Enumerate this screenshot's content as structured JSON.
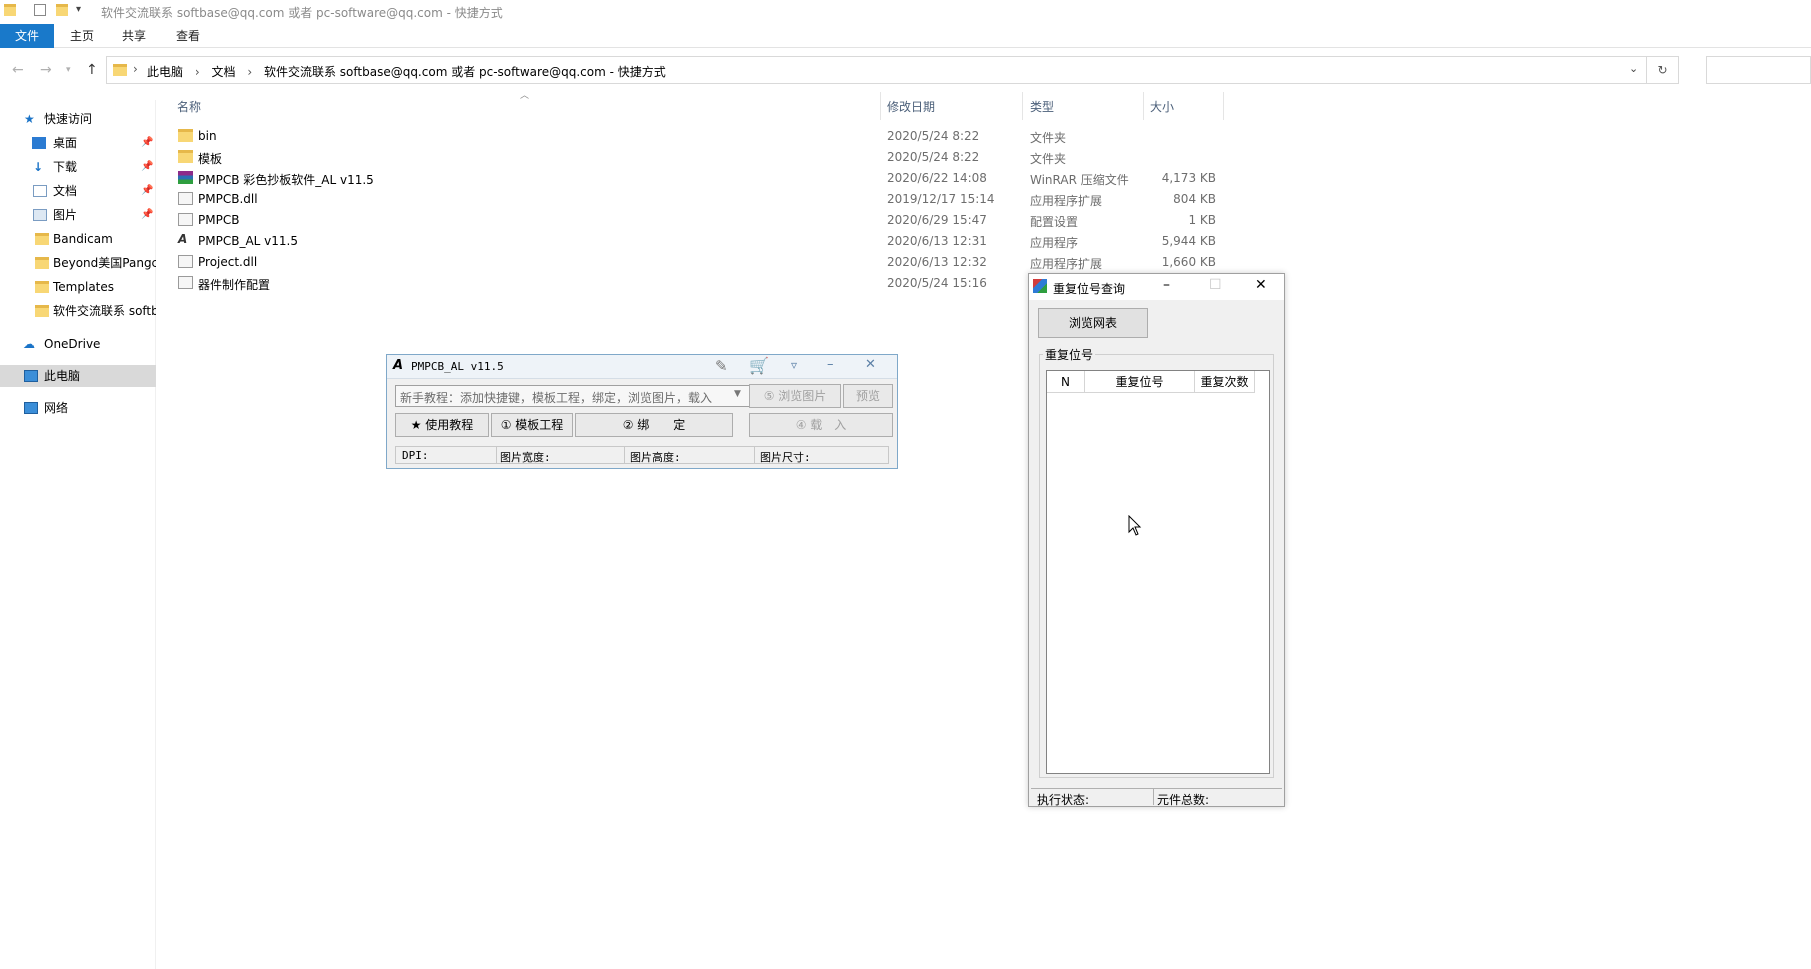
{
  "explorer": {
    "window_title": "软件交流联系 softbase@qq.com 或者 pc-software@qq.com - 快捷方式",
    "ribbon_tabs": [
      "文件",
      "主页",
      "共享",
      "查看"
    ],
    "breadcrumbs": [
      "此电脑",
      "文档",
      "软件交流联系 softbase@qq.com 或者 pc-software@qq.com - 快捷方式"
    ],
    "columns": {
      "name": "名称",
      "date": "修改日期",
      "type": "类型",
      "size": "大小"
    },
    "nav": [
      {
        "label": "快速访问"
      },
      {
        "label": "桌面"
      },
      {
        "label": "下载"
      },
      {
        "label": "文档"
      },
      {
        "label": "图片"
      },
      {
        "label": "Bandicam"
      },
      {
        "label": "Beyond美国Pangc"
      },
      {
        "label": "Templates"
      },
      {
        "label": "软件交流联系 softb"
      },
      {
        "label": "OneDrive"
      },
      {
        "label": "此电脑"
      },
      {
        "label": "网络"
      }
    ],
    "files": [
      {
        "name": "bin",
        "date": "2020/5/24 8:22",
        "type": "文件夹",
        "size": ""
      },
      {
        "name": "模板",
        "date": "2020/5/24 8:22",
        "type": "文件夹",
        "size": ""
      },
      {
        "name": "PMPCB 彩色抄板软件_AL v11.5",
        "date": "2020/6/22 14:08",
        "type": "WinRAR 压缩文件",
        "size": "4,173 KB"
      },
      {
        "name": "PMPCB.dll",
        "date": "2019/12/17 15:14",
        "type": "应用程序扩展",
        "size": "804 KB"
      },
      {
        "name": "PMPCB",
        "date": "2020/6/29 15:47",
        "type": "配置设置",
        "size": "1 KB"
      },
      {
        "name": "PMPCB_AL v11.5",
        "date": "2020/6/13 12:31",
        "type": "应用程序",
        "size": "5,944 KB"
      },
      {
        "name": "Project.dll",
        "date": "2020/6/13 12:32",
        "type": "应用程序扩展",
        "size": "1,660 KB"
      },
      {
        "name": "器件制作配置",
        "date": "2020/5/24 15:16",
        "type": "",
        "size": ""
      }
    ]
  },
  "pmpcb": {
    "title": "PMPCB_AL v11.5",
    "combo_text": "新手教程：添加快捷键，模板工程，绑定，浏览图片，载入",
    "browse_label": "⑤ 浏览图片",
    "preview_label": "预览",
    "tutorial_label": "★ 使用教程",
    "template_label": "① 模板工程",
    "bind_label": "② 绑　　定",
    "load_label": "④ 载　入",
    "status": {
      "dpi": "DPI:",
      "width": "图片宽度:",
      "height": "图片高度:",
      "size": "图片尺寸:"
    }
  },
  "dup": {
    "title": "重复位号查询",
    "browse_button": "浏览网表",
    "group_label": "重复位号",
    "columns": [
      "N",
      "重复位号",
      "重复次数"
    ],
    "status_exec": "执行状态:",
    "status_total": "元件总数:"
  }
}
